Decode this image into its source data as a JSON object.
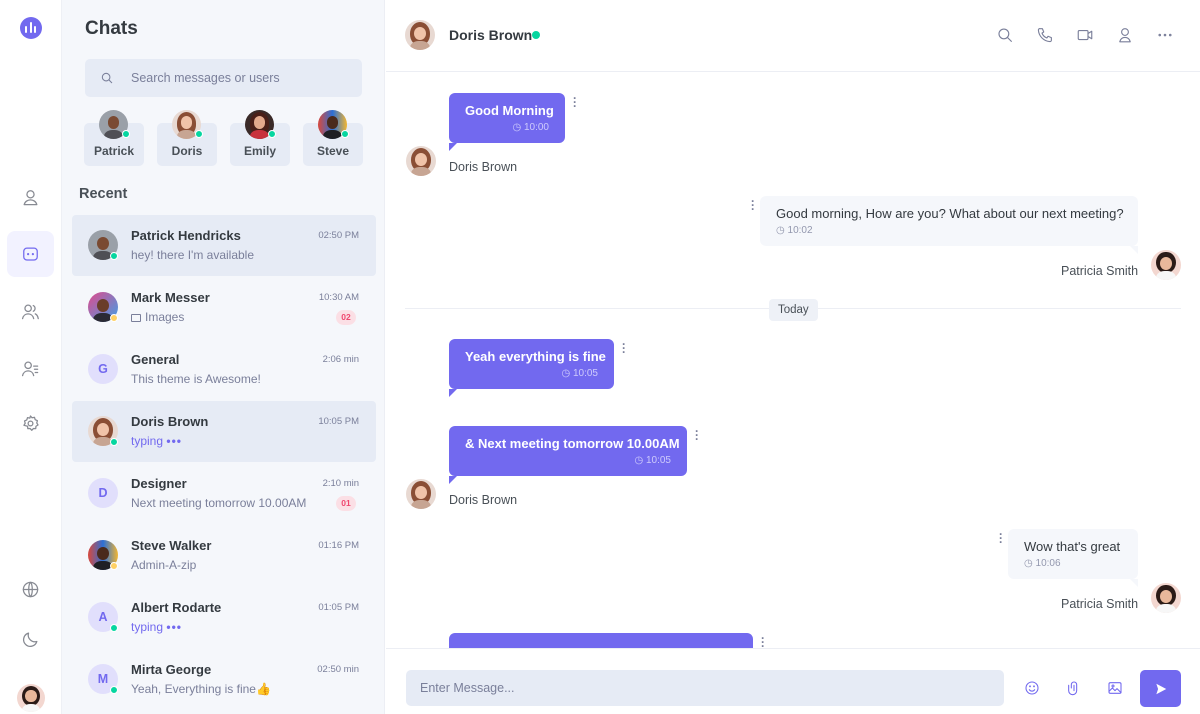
{
  "app": {
    "brand_color": "#7269ef",
    "online_color": "#06d6a0",
    "away_color": "#ffd166"
  },
  "rail": {
    "logo_icon": "waveform-chat-logo",
    "items": [
      {
        "icon": "user-icon",
        "active": false
      },
      {
        "icon": "chat-icon",
        "active": true
      },
      {
        "icon": "users-icon",
        "active": false
      },
      {
        "icon": "contacts-icon",
        "active": false
      },
      {
        "icon": "gear-icon",
        "active": false
      }
    ],
    "bottom": [
      {
        "icon": "globe-icon"
      },
      {
        "icon": "moon-icon"
      }
    ]
  },
  "chats_panel": {
    "title": "Chats",
    "search_placeholder": "Search messages or users",
    "favorites": [
      {
        "name": "Patrick"
      },
      {
        "name": "Doris"
      },
      {
        "name": "Emily"
      },
      {
        "name": "Steve"
      }
    ],
    "recent_label": "Recent",
    "items": [
      {
        "name": "Patrick Hendricks",
        "preview": "hey! there I'm available",
        "time": "02:50 PM",
        "status": "online",
        "active": true
      },
      {
        "name": "Mark Messer",
        "preview": "Images",
        "time": "10:30 AM",
        "status": "away",
        "badge": "02"
      },
      {
        "name": "General",
        "preview": "This theme is Awesome!",
        "time": "2:06 min",
        "initial": "G"
      },
      {
        "name": "Doris Brown",
        "preview": "typing",
        "time": "10:05 PM",
        "status": "online",
        "typing": true,
        "active": true
      },
      {
        "name": "Designer",
        "preview": "Next meeting tomorrow 10.00AM",
        "time": "2:10 min",
        "initial": "D",
        "badge": "01"
      },
      {
        "name": "Steve Walker",
        "preview": "Admin-A-zip",
        "time": "01:16 PM",
        "status": "away"
      },
      {
        "name": "Albert Rodarte",
        "preview": "typing",
        "time": "01:05 PM",
        "initial": "A",
        "status": "online",
        "typing": true
      },
      {
        "name": "Mirta George",
        "preview": "Yeah, Everything is fine👍",
        "time": "02:50 min",
        "initial": "M",
        "status": "online"
      }
    ]
  },
  "conversation": {
    "contact_name": "Doris Brown",
    "contact_status": "online",
    "header_icons": [
      "search-icon",
      "phone-icon",
      "video-icon",
      "user-icon",
      "more-icon"
    ],
    "day_separator": "Today",
    "messages": [
      {
        "dir": "in",
        "text": "Good Morning",
        "time": "10:00",
        "sender": "Doris Brown"
      },
      {
        "dir": "out",
        "text": "Good morning, How are you? What about our next meeting?",
        "time": "10:02",
        "sender": "Patricia Smith"
      },
      {
        "dir": "in",
        "text": "Yeah everything is fine",
        "time": "10:05"
      },
      {
        "dir": "in",
        "text": "& Next meeting tomorrow 10.00AM",
        "time": "10:05",
        "sender": "Doris Brown"
      },
      {
        "dir": "out",
        "text": "Wow that's great",
        "time": "10:06",
        "sender": "Patricia Smith"
      }
    ],
    "composer_placeholder": "Enter Message...",
    "composer_icons": [
      "emoji-icon",
      "attachment-icon",
      "image-icon",
      "send-icon"
    ]
  }
}
